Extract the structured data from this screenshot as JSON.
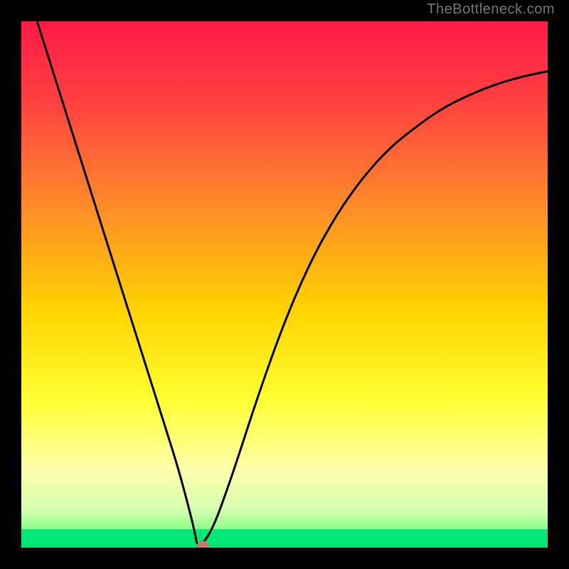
{
  "watermark": "TheBottleneck.com",
  "chart_data": {
    "type": "line",
    "title": "",
    "xlabel": "",
    "ylabel": "",
    "xlim": [
      0,
      1
    ],
    "ylim": [
      0,
      1
    ],
    "background": {
      "type": "vertical-gradient",
      "stops": [
        {
          "offset": 0.0,
          "color": "#ff1a47"
        },
        {
          "offset": 0.15,
          "color": "#ff4040"
        },
        {
          "offset": 0.35,
          "color": "#ff8a2a"
        },
        {
          "offset": 0.55,
          "color": "#ffd400"
        },
        {
          "offset": 0.72,
          "color": "#ffff33"
        },
        {
          "offset": 0.85,
          "color": "#ffffaa"
        },
        {
          "offset": 0.93,
          "color": "#d4ffb0"
        },
        {
          "offset": 0.97,
          "color": "#80ff80"
        },
        {
          "offset": 1.0,
          "color": "#00e676"
        }
      ]
    },
    "curve": {
      "stroke": "#000000",
      "stroke_width": 3,
      "x": [
        0.03,
        0.06,
        0.09,
        0.12,
        0.15,
        0.18,
        0.21,
        0.24,
        0.27,
        0.3,
        0.33,
        0.334,
        0.36,
        0.4,
        0.45,
        0.5,
        0.55,
        0.6,
        0.65,
        0.7,
        0.75,
        0.8,
        0.85,
        0.9,
        0.95,
        1.0
      ],
      "y": [
        1.0,
        0.905,
        0.81,
        0.715,
        0.62,
        0.525,
        0.43,
        0.335,
        0.24,
        0.145,
        0.03,
        0.0,
        0.025,
        0.135,
        0.29,
        0.43,
        0.545,
        0.635,
        0.705,
        0.76,
        0.8,
        0.835,
        0.86,
        0.88,
        0.895,
        0.905
      ]
    },
    "marker": {
      "x": 0.345,
      "y": 0.005,
      "color": "#c97a6a",
      "rx": 8,
      "ry": 6
    },
    "green_band": {
      "y_top": 0.965,
      "y_bottom": 1.0
    }
  }
}
